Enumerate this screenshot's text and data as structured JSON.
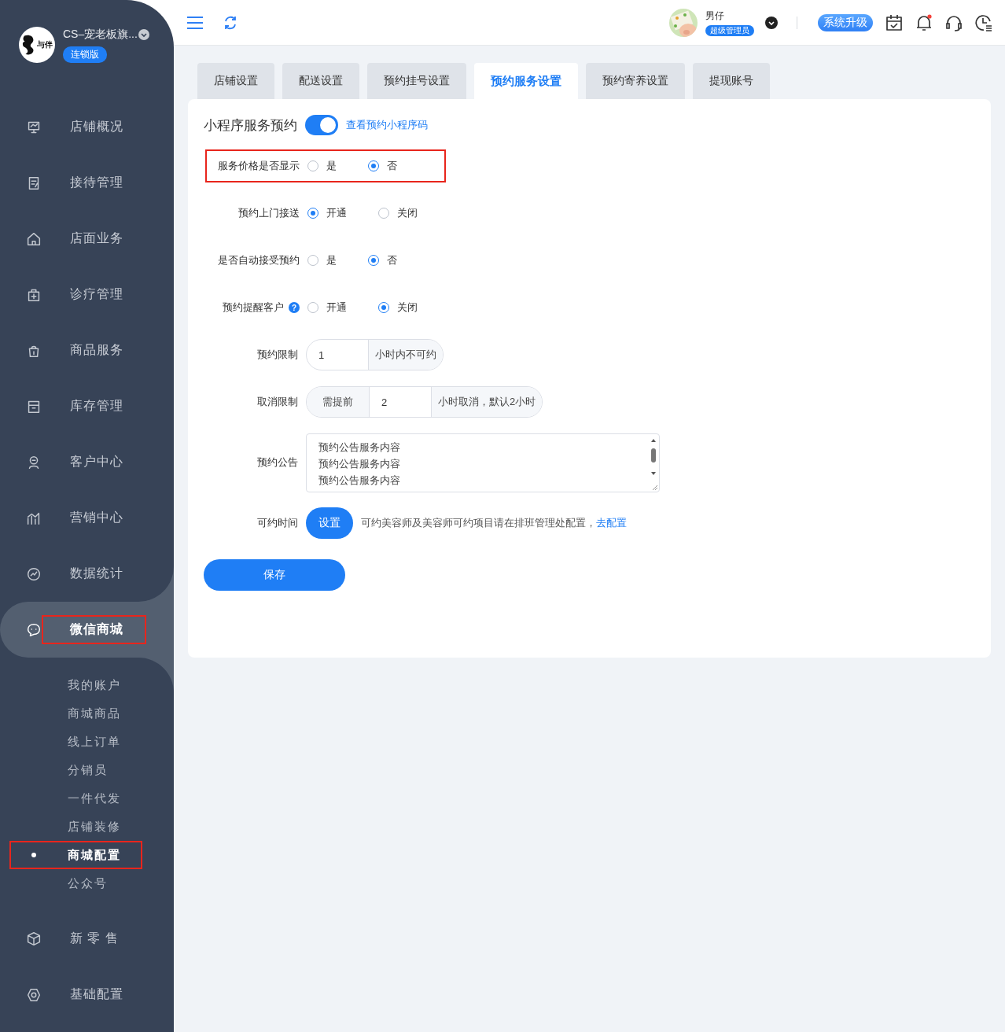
{
  "sidebar": {
    "logo_text": "与伴",
    "shop_name": "CS–宠老板旗...",
    "edition_badge": "连锁版",
    "menu": [
      {
        "label": "店铺概况",
        "selected": false,
        "annotated": false
      },
      {
        "label": "接待管理",
        "selected": false,
        "annotated": false
      },
      {
        "label": "店面业务",
        "selected": false,
        "annotated": false
      },
      {
        "label": "诊疗管理",
        "selected": false,
        "annotated": false
      },
      {
        "label": "商品服务",
        "selected": false,
        "annotated": false
      },
      {
        "label": "库存管理",
        "selected": false,
        "annotated": false
      },
      {
        "label": "客户中心",
        "selected": false,
        "annotated": false
      },
      {
        "label": "营销中心",
        "selected": false,
        "annotated": false
      },
      {
        "label": "数据统计",
        "selected": false,
        "annotated": false
      },
      {
        "label": "微信商城",
        "selected": true,
        "annotated": true,
        "children": [
          {
            "label": "我的账户",
            "selected": false,
            "annotated": false
          },
          {
            "label": "商城商品",
            "selected": false,
            "annotated": false
          },
          {
            "label": "线上订单",
            "selected": false,
            "annotated": false
          },
          {
            "label": "分销员",
            "selected": false,
            "annotated": false
          },
          {
            "label": "一件代发",
            "selected": false,
            "annotated": false
          },
          {
            "label": "店铺装修",
            "selected": false,
            "annotated": false
          },
          {
            "label": "商城配置",
            "selected": true,
            "annotated": true
          },
          {
            "label": "公众号",
            "selected": false,
            "annotated": false
          }
        ]
      },
      {
        "label": "新 零 售",
        "selected": false,
        "annotated": false
      },
      {
        "label": "基础配置",
        "selected": false,
        "annotated": false
      }
    ]
  },
  "topbar": {
    "user_name": "男仔",
    "role_badge": "超级管理员",
    "upgrade_button": "系统升级",
    "has_notification": true
  },
  "tabs": [
    {
      "label": "店铺设置",
      "selected": false
    },
    {
      "label": "配送设置",
      "selected": false
    },
    {
      "label": "预约挂号设置",
      "selected": false
    },
    {
      "label": "预约服务设置",
      "selected": true
    },
    {
      "label": "预约寄养设置",
      "selected": false
    },
    {
      "label": "提现账号",
      "selected": false
    }
  ],
  "form": {
    "mini_program": {
      "title": "小程序服务预约",
      "on": true,
      "link": "查看预约小程序码"
    },
    "radio_rows": [
      {
        "label": "服务价格是否显示",
        "annotated": true,
        "options": [
          {
            "label": "是",
            "selected": false
          },
          {
            "label": "否",
            "selected": true
          }
        ]
      },
      {
        "label": "预约上门接送",
        "annotated": false,
        "options": [
          {
            "label": "开通",
            "selected": true
          },
          {
            "label": "关闭",
            "selected": false
          }
        ]
      },
      {
        "label": "是否自动接受预约",
        "annotated": false,
        "options": [
          {
            "label": "是",
            "selected": false
          },
          {
            "label": "否",
            "selected": true
          }
        ]
      },
      {
        "label": "预约提醒客户",
        "annotated": false,
        "help_mark": "?",
        "options": [
          {
            "label": "开通",
            "selected": false
          },
          {
            "label": "关闭",
            "selected": true
          }
        ]
      }
    ],
    "booking_limit": {
      "label": "预约限制",
      "value": "1",
      "suffix": "小时内不可约"
    },
    "cancel_limit": {
      "label": "取消限制",
      "prefix": "需提前",
      "value": "2",
      "suffix": "小时取消，默认2小时"
    },
    "notice": {
      "label": "预约公告",
      "lines": [
        "预约公告服务内容",
        "预约公告服务内容",
        "预约公告服务内容"
      ]
    },
    "available_time": {
      "label": "可约时间",
      "button": "设置",
      "note": "可约美容师及美容师可约项目请在排班管理处配置，",
      "link": "去配置"
    },
    "save_button": "保存"
  }
}
